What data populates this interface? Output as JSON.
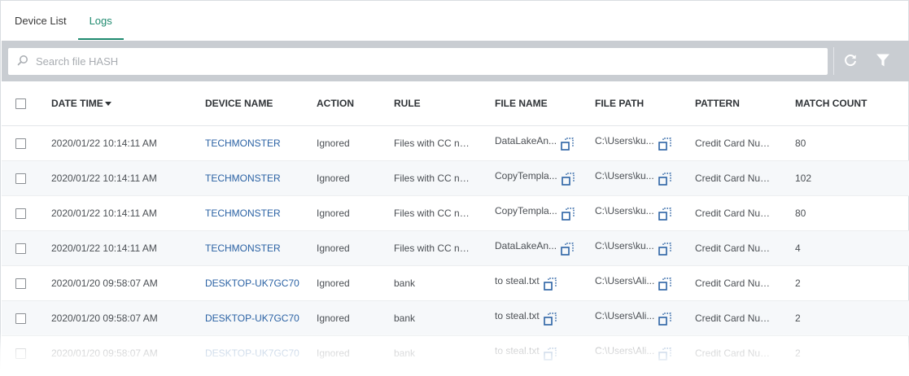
{
  "tabs": [
    {
      "label": "Device List",
      "active": false
    },
    {
      "label": "Logs",
      "active": true
    }
  ],
  "search": {
    "placeholder": "Search file HASH",
    "value": ""
  },
  "toolbar": {
    "refresh_icon": "refresh-icon",
    "filter_icon": "filter-icon"
  },
  "table": {
    "columns": [
      "DATE TIME",
      "DEVICE NAME",
      "ACTION",
      "RULE",
      "FILE NAME",
      "FILE PATH",
      "PATTERN",
      "MATCH COUNT"
    ],
    "sort_column": "DATE TIME",
    "sort_direction": "descending",
    "rows": [
      {
        "date": "2020/01/22 10:14:11 AM",
        "device": "TECHMONSTER",
        "action": "Ignored",
        "rule": "Files with CC nu...",
        "file_name": "DataLakeAn...",
        "file_path": "C:\\Users\\ku...",
        "pattern": "Credit Card Num...",
        "count": "80"
      },
      {
        "date": "2020/01/22 10:14:11 AM",
        "device": "TECHMONSTER",
        "action": "Ignored",
        "rule": "Files with CC nu...",
        "file_name": "CopyTempla...",
        "file_path": "C:\\Users\\ku...",
        "pattern": "Credit Card Num...",
        "count": "102"
      },
      {
        "date": "2020/01/22 10:14:11 AM",
        "device": "TECHMONSTER",
        "action": "Ignored",
        "rule": "Files with CC nu...",
        "file_name": "CopyTempla...",
        "file_path": "C:\\Users\\ku...",
        "pattern": "Credit Card Num...",
        "count": "80"
      },
      {
        "date": "2020/01/22 10:14:11 AM",
        "device": "TECHMONSTER",
        "action": "Ignored",
        "rule": "Files with CC nu...",
        "file_name": "DataLakeAn...",
        "file_path": "C:\\Users\\ku...",
        "pattern": "Credit Card Num...",
        "count": "4"
      },
      {
        "date": "2020/01/20 09:58:07 AM",
        "device": "DESKTOP-UK7GC70",
        "action": "Ignored",
        "rule": "bank",
        "file_name": "to steal.txt",
        "file_path": "C:\\Users\\Ali...",
        "pattern": "Credit Card Num...",
        "count": "2"
      },
      {
        "date": "2020/01/20 09:58:07 AM",
        "device": "DESKTOP-UK7GC70",
        "action": "Ignored",
        "rule": "bank",
        "file_name": "to steal.txt",
        "file_path": "C:\\Users\\Ali...",
        "pattern": "Credit Card Num...",
        "count": "2"
      },
      {
        "date": "2020/01/20 09:58:07 AM",
        "device": "DESKTOP-UK7GC70",
        "action": "Ignored",
        "rule": "bank",
        "file_name": "to steal.txt",
        "file_path": "C:\\Users\\Ali...",
        "pattern": "Credit Card Num...",
        "count": "2"
      }
    ]
  },
  "colors": {
    "accent": "#1f8a6f",
    "link": "#2b62a4",
    "toolbar_bg": "#c9cdd2",
    "copy_icon": "#2b62a4"
  }
}
